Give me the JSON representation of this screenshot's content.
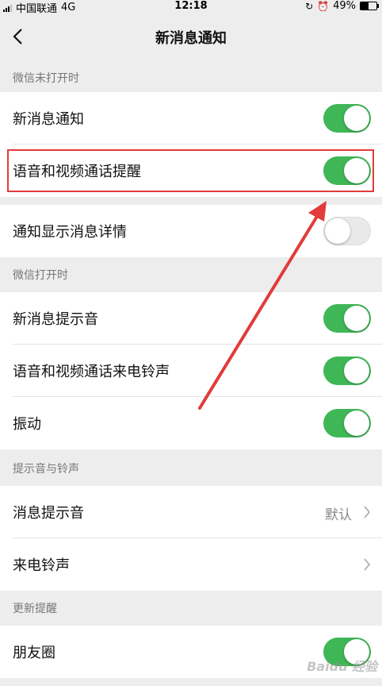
{
  "status_bar": {
    "carrier": "中国联通",
    "network": "4G",
    "time": "12:18",
    "battery": "49%",
    "battery_level": 0.49
  },
  "nav": {
    "title": "新消息通知"
  },
  "sections": {
    "closed": "微信未打开时",
    "opened": "微信打开时",
    "sounds": "提示音与铃声",
    "updates": "更新提醒"
  },
  "rows": {
    "new_message": {
      "label": "新消息通知",
      "on": true
    },
    "voice_video_remind": {
      "label": "语音和视频通话提醒",
      "on": true
    },
    "show_details": {
      "label": "通知显示消息详情",
      "on": false
    },
    "new_message_sound": {
      "label": "新消息提示音",
      "on": true
    },
    "voice_video_ringtone": {
      "label": "语音和视频通话来电铃声",
      "on": true
    },
    "vibrate": {
      "label": "振动",
      "on": true
    },
    "message_tone": {
      "label": "消息提示音",
      "value": "默认"
    },
    "ringtone": {
      "label": "来电铃声"
    },
    "moments": {
      "label": "朋友圈",
      "on": true
    }
  },
  "colors": {
    "toggle_on": "#3fb756",
    "annotation_red": "#e23b3b"
  },
  "watermark": "Baidu 经验"
}
